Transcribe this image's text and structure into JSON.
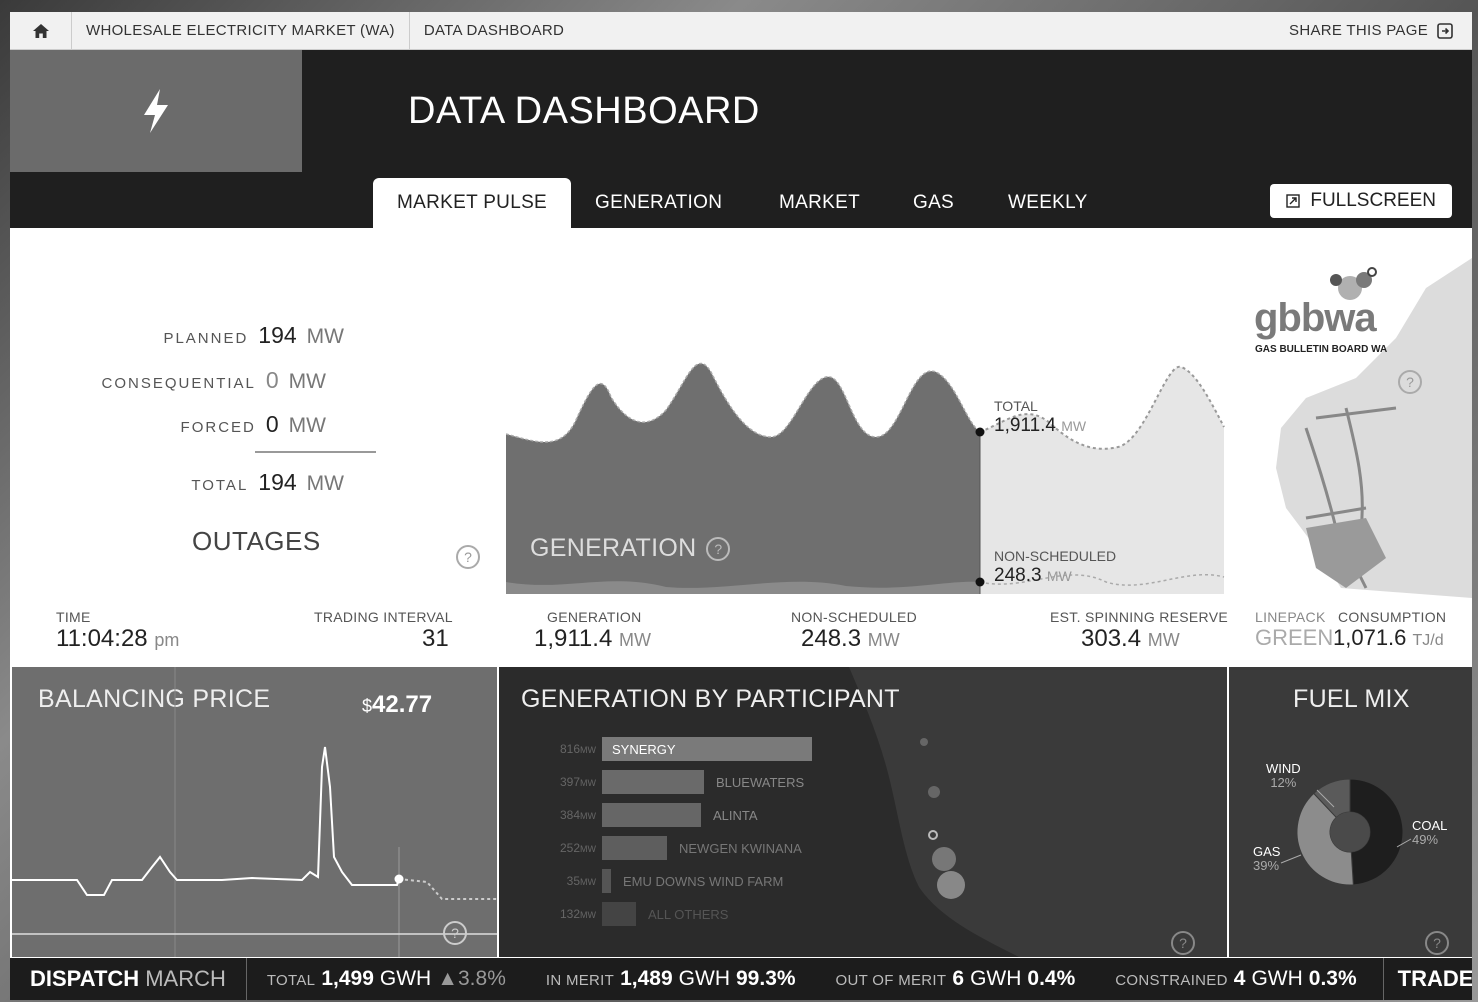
{
  "breadcrumb": {
    "site": "WHOLESALE ELECTRICITY MARKET (WA)",
    "page": "DATA DASHBOARD",
    "share_label": "SHARE THIS PAGE"
  },
  "header": {
    "title": "DATA DASHBOARD"
  },
  "tabs": [
    {
      "label": "MARKET PULSE",
      "active": true
    },
    {
      "label": "GENERATION",
      "active": false
    },
    {
      "label": "MARKET",
      "active": false
    },
    {
      "label": "GAS",
      "active": false
    },
    {
      "label": "WEEKLY",
      "active": false
    }
  ],
  "fullscreen_label": "FULLSCREEN",
  "outages": {
    "title": "OUTAGES",
    "planned": {
      "label": "PLANNED",
      "value": "194",
      "unit": "MW"
    },
    "consequential": {
      "label": "CONSEQUENTIAL",
      "value": "0",
      "unit": "MW"
    },
    "forced": {
      "label": "FORCED",
      "value": "0",
      "unit": "MW"
    },
    "total": {
      "label": "TOTAL",
      "value": "194",
      "unit": "MW"
    }
  },
  "generation_chart": {
    "label": "GENERATION",
    "total_label": "TOTAL",
    "total_value": "1,911.4",
    "total_unit": "MW",
    "nonsched_label": "NON-SCHEDULED",
    "nonsched_value": "248.3",
    "nonsched_unit": "MW"
  },
  "gbb": {
    "logo_text": "gbbwa",
    "logo_subtitle": "GAS BULLETIN BOARD WA"
  },
  "stats": {
    "time": {
      "label": "TIME",
      "value": "11:04:28",
      "unit": "pm"
    },
    "trading_interval": {
      "label": "TRADING INTERVAL",
      "value": "31"
    },
    "generation": {
      "label": "GENERATION",
      "value": "1,911.4",
      "unit": "MW"
    },
    "non_scheduled": {
      "label": "NON-SCHEDULED",
      "value": "248.3",
      "unit": "MW"
    },
    "spinning_reserve": {
      "label": "EST. SPINNING RESERVE",
      "value": "303.4",
      "unit": "MW"
    },
    "linepack": {
      "label": "LINEPACK",
      "value": "GREEN"
    },
    "consumption": {
      "label": "CONSUMPTION",
      "value": "1,071.6",
      "unit": "TJ/d"
    }
  },
  "balancing": {
    "title": "BALANCING PRICE",
    "price_symbol": "$",
    "price": "42.77"
  },
  "participants": {
    "title": "GENERATION BY PARTICIPANT",
    "unit": "MW",
    "items": [
      {
        "name": "SYNERGY",
        "value": 816,
        "label": "816"
      },
      {
        "name": "BLUEWATERS",
        "value": 397,
        "label": "397"
      },
      {
        "name": "ALINTA",
        "value": 384,
        "label": "384"
      },
      {
        "name": "NEWGEN KWINANA",
        "value": 252,
        "label": "252"
      },
      {
        "name": "EMU DOWNS WIND FARM",
        "value": 35,
        "label": "35"
      },
      {
        "name": "ALL OTHERS",
        "value": 132,
        "label": "132"
      }
    ]
  },
  "fuel_mix": {
    "title": "FUEL MIX",
    "slices": [
      {
        "name": "COAL",
        "pct": 49,
        "label": "49%",
        "color": "#1e1e1e"
      },
      {
        "name": "GAS",
        "pct": 39,
        "label": "39%",
        "color": "#8c8c8c"
      },
      {
        "name": "WIND",
        "pct": 12,
        "label": "12%",
        "color": "#5a5a5a"
      }
    ]
  },
  "footer": {
    "dispatch": "DISPATCH",
    "month": "MARCH",
    "total_label": "TOTAL",
    "total_value": "1,499",
    "total_unit": "GWH",
    "total_change": "▲3.8%",
    "in_merit_label": "IN MERIT",
    "in_merit_value": "1,489",
    "in_merit_unit": "GWH",
    "in_merit_pct": "99.3%",
    "out_merit_label": "OUT OF MERIT",
    "out_merit_value": "6",
    "out_merit_unit": "GWH",
    "out_merit_pct": "0.4%",
    "constrained_label": "CONSTRAINED",
    "constrained_value": "4",
    "constrained_unit": "GWH",
    "constrained_pct": "0.3%",
    "trade_label": "TRADE VOLU"
  }
}
